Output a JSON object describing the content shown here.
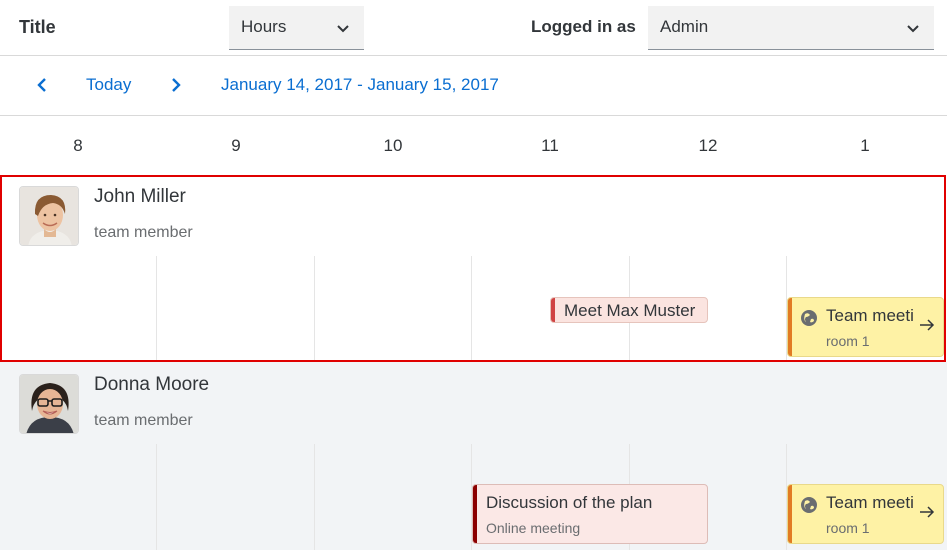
{
  "toolbar": {
    "title": "Title",
    "view_select": {
      "value": "Hours"
    },
    "logged_label": "Logged in as",
    "user_select": {
      "value": "Admin"
    }
  },
  "nav": {
    "today_label": "Today",
    "date_range": "January 14, 2017 - January 15, 2017"
  },
  "hours": [
    "8",
    "9",
    "10",
    "11",
    "12",
    "1"
  ],
  "rows": [
    {
      "name": "John Miller",
      "role": "team member",
      "selected": true,
      "appointments": [
        {
          "title": "Meet Max Muster",
          "accent": "#d04343"
        },
        {
          "title": "Team meeti",
          "subtitle": "room 1",
          "icon": "globe-icon",
          "accent": "#e17b24"
        }
      ]
    },
    {
      "name": "Donna Moore",
      "role": "team member",
      "selected": false,
      "appointments": [
        {
          "title": "Discussion of the plan",
          "subtitle": "Online meeting",
          "accent": "#8b0000"
        },
        {
          "title": "Team meeti",
          "subtitle": "room 1",
          "icon": "globe-icon",
          "accent": "#e17b24"
        }
      ]
    }
  ],
  "colors": {
    "accent_blue": "#0a6ed1",
    "selection_border": "#e00000",
    "appointment_orange_bg": "#fef2a5",
    "appointment_red_bg": "#fbe4e0"
  }
}
